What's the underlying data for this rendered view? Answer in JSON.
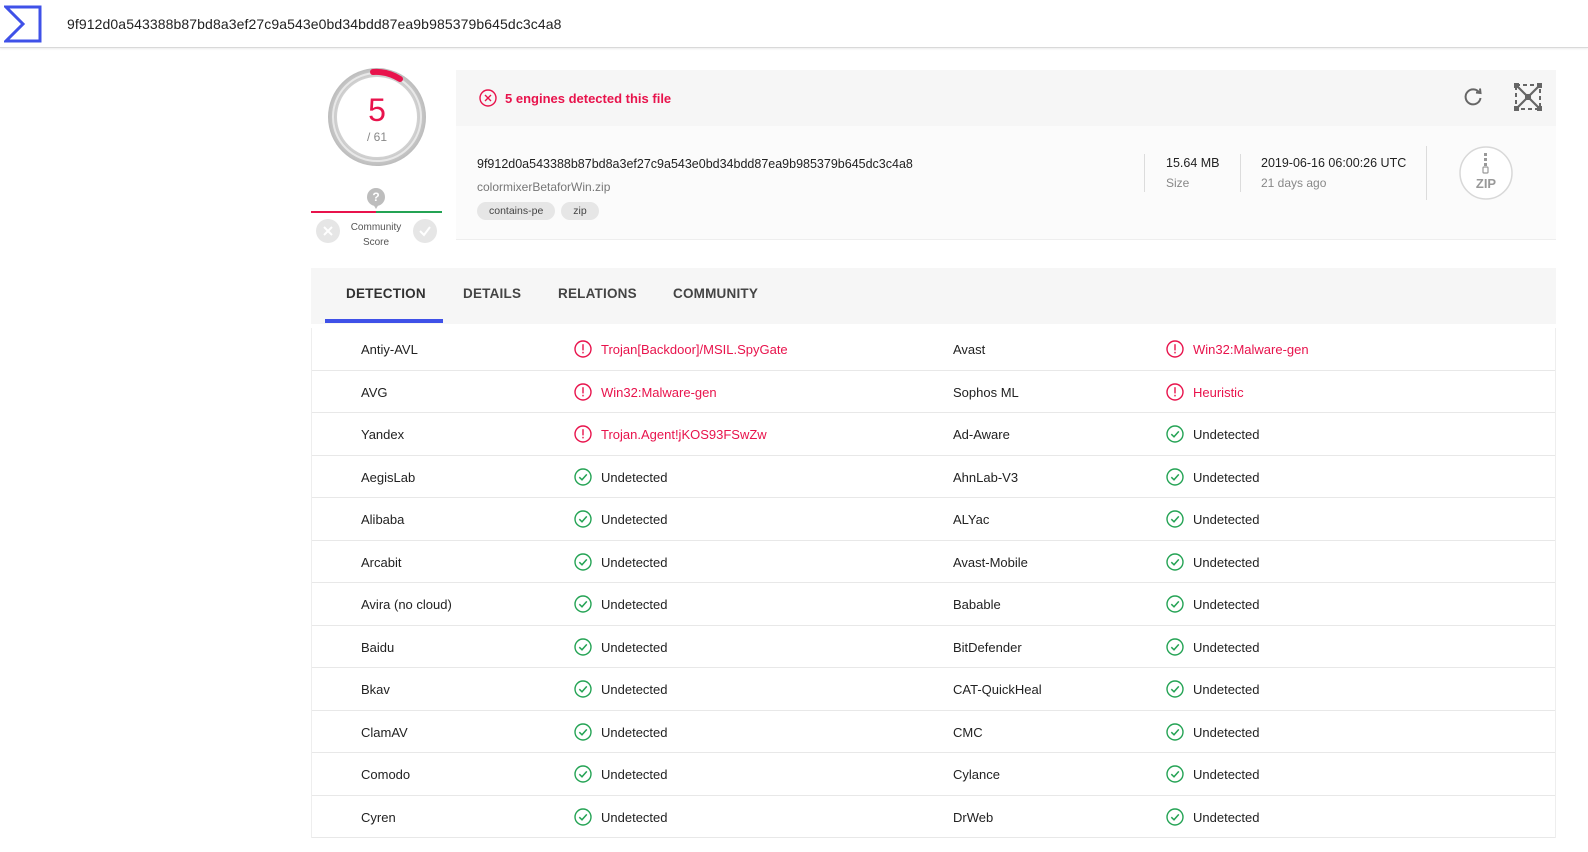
{
  "topbar": {
    "search_value": "9f912d0a543388b87bd8a3ef27c9a543e0bd34bdd87ea9b985379b645dc3c4a8"
  },
  "score": {
    "detected": "5",
    "total": "/ 61"
  },
  "community": {
    "label_line1": "Community",
    "label_line2": "Score",
    "question": "?"
  },
  "alert": {
    "text": "5 engines detected this file"
  },
  "file": {
    "hash": "9f912d0a543388b87bd8a3ef27c9a543e0bd34bdd87ea9b985379b645dc3c4a8",
    "name": "colormixerBetaforWin.zip",
    "tags": [
      "contains-pe",
      "zip"
    ],
    "size_value": "15.64 MB",
    "size_label": "Size",
    "date_value": "2019-06-16 06:00:26 UTC",
    "date_label": "21 days ago",
    "type_label": "ZIP"
  },
  "tabs": [
    "DETECTION",
    "DETAILS",
    "RELATIONS",
    "COMMUNITY"
  ],
  "colors": {
    "danger": "#e8134c",
    "ok": "#24a354",
    "accent": "#3f51e8"
  },
  "detections": [
    [
      [
        "Antiy-AVL",
        "Trojan[Backdoor]/MSIL.SpyGate",
        "bad"
      ],
      [
        "Avast",
        "Win32:Malware-gen",
        "bad"
      ]
    ],
    [
      [
        "AVG",
        "Win32:Malware-gen",
        "bad"
      ],
      [
        "Sophos ML",
        "Heuristic",
        "bad"
      ]
    ],
    [
      [
        "Yandex",
        "Trojan.Agent!jKOS93FSwZw",
        "bad"
      ],
      [
        "Ad-Aware",
        "Undetected",
        "good"
      ]
    ],
    [
      [
        "AegisLab",
        "Undetected",
        "good"
      ],
      [
        "AhnLab-V3",
        "Undetected",
        "good"
      ]
    ],
    [
      [
        "Alibaba",
        "Undetected",
        "good"
      ],
      [
        "ALYac",
        "Undetected",
        "good"
      ]
    ],
    [
      [
        "Arcabit",
        "Undetected",
        "good"
      ],
      [
        "Avast-Mobile",
        "Undetected",
        "good"
      ]
    ],
    [
      [
        "Avira (no cloud)",
        "Undetected",
        "good"
      ],
      [
        "Babable",
        "Undetected",
        "good"
      ]
    ],
    [
      [
        "Baidu",
        "Undetected",
        "good"
      ],
      [
        "BitDefender",
        "Undetected",
        "good"
      ]
    ],
    [
      [
        "Bkav",
        "Undetected",
        "good"
      ],
      [
        "CAT-QuickHeal",
        "Undetected",
        "good"
      ]
    ],
    [
      [
        "ClamAV",
        "Undetected",
        "good"
      ],
      [
        "CMC",
        "Undetected",
        "good"
      ]
    ],
    [
      [
        "Comodo",
        "Undetected",
        "good"
      ],
      [
        "Cylance",
        "Undetected",
        "good"
      ]
    ],
    [
      [
        "Cyren",
        "Undetected",
        "good"
      ],
      [
        "DrWeb",
        "Undetected",
        "good"
      ]
    ]
  ]
}
